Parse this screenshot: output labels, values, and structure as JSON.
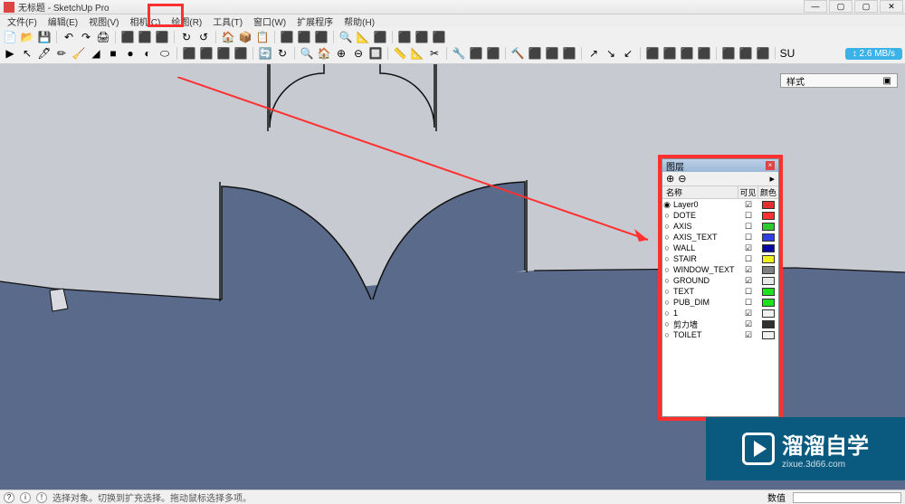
{
  "window": {
    "title": "无标题 - SketchUp Pro",
    "controls": {
      "min": "—",
      "max": "▢",
      "close": "✕",
      "extra": "▢"
    }
  },
  "menu": [
    "文件(F)",
    "编辑(E)",
    "视图(V)",
    "相机(C)",
    "绘图(R)",
    "工具(T)",
    "窗口(W)",
    "扩展程序",
    "帮助(H)"
  ],
  "speed_badge": "↕ 2.6 MB/s",
  "styles_badge": "样式",
  "layers_panel": {
    "title": "图层",
    "headers": {
      "name": "名称",
      "visible": "可见",
      "color": "颜色"
    },
    "layers": [
      {
        "name": "Layer0",
        "selected": true,
        "visible": true,
        "color": "#e03030"
      },
      {
        "name": "DOTE",
        "selected": false,
        "visible": false,
        "color": "#ff3030"
      },
      {
        "name": "AXIS",
        "selected": false,
        "visible": false,
        "color": "#30c830"
      },
      {
        "name": "AXIS_TEXT",
        "selected": false,
        "visible": false,
        "color": "#3040e0"
      },
      {
        "name": "WALL",
        "selected": false,
        "visible": true,
        "color": "#0808a0"
      },
      {
        "name": "STAIR",
        "selected": false,
        "visible": false,
        "color": "#f0f020"
      },
      {
        "name": "WINDOW_TEXT",
        "selected": false,
        "visible": true,
        "color": "#808080"
      },
      {
        "name": "GROUND",
        "selected": false,
        "visible": true,
        "color": "#e8e8e8"
      },
      {
        "name": "TEXT",
        "selected": false,
        "visible": false,
        "color": "#20e020"
      },
      {
        "name": "PUB_DIM",
        "selected": false,
        "visible": false,
        "color": "#20e020"
      },
      {
        "name": "1",
        "selected": false,
        "visible": true,
        "color": "#f0f0f0"
      },
      {
        "name": "剪力墙",
        "selected": false,
        "visible": true,
        "color": "#303030"
      },
      {
        "name": "TOILET",
        "selected": false,
        "visible": true,
        "color": "#f0f0f0"
      }
    ]
  },
  "watermark": {
    "main": "溜溜自学",
    "sub": "zixue.3d66.com"
  },
  "statusbar": {
    "icons": [
      "?",
      "i",
      "!"
    ],
    "hint": "选择对象。切换到扩充选择。拖动鼠标选择多项。",
    "value_label": "数值",
    "value": ""
  },
  "toolbar_icons_row1": [
    "📄",
    "📂",
    "💾",
    "|",
    "↶",
    "↷",
    "🖨",
    "|",
    "⬛",
    "⬛",
    "⬛",
    "|",
    "↻",
    "↺",
    "|",
    "🏠",
    "📦",
    "📋",
    "|",
    "⬛",
    "⬛",
    "⬛",
    "|",
    "🔍",
    "📐",
    "⬛",
    "|",
    "⬛",
    "⬛",
    "⬛"
  ],
  "toolbar_icons_row2": [
    "▶",
    "↖",
    "🖊",
    "✏",
    "🧹",
    "◢",
    "■",
    "●",
    "◐",
    "⬭",
    "|",
    "⬛",
    "⬛",
    "⬛",
    "⬛",
    "|",
    "🔄",
    "↻",
    "|",
    "🔍",
    "🏠",
    "⊕",
    "⊖",
    "🔲",
    "|",
    "📏",
    "📐",
    "✂",
    "|",
    "🔧",
    "⬛",
    "⬛",
    "|",
    "🔨",
    "⬛",
    "⬛",
    "⬛",
    "|",
    "↗",
    "↘",
    "↙",
    "|",
    "⬛",
    "⬛",
    "⬛",
    "⬛",
    "|",
    "⬛",
    "⬛",
    "⬛",
    "|",
    "SU"
  ]
}
